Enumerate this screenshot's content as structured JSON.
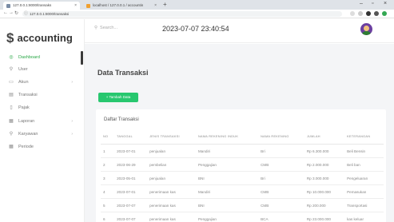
{
  "browser": {
    "tabs": [
      {
        "title": "127.0.0.1:8000/transaks",
        "active": true
      },
      {
        "title": "localhost / 127.0.0.1 / accountin",
        "active": false
      }
    ],
    "url": "127.0.0.1:8000/transaksi"
  },
  "sidebar": {
    "brand": "accounting",
    "items": [
      {
        "label": "Dashboard",
        "icon": "dashboard-icon",
        "glyph": "◎",
        "active": true,
        "chevron": false
      },
      {
        "label": "User",
        "icon": "user-icon",
        "glyph": "⚲",
        "active": false,
        "chevron": false
      },
      {
        "label": "Akun",
        "icon": "folder-icon",
        "glyph": "▭",
        "active": false,
        "chevron": true
      },
      {
        "label": "Transaksi",
        "icon": "transaction-icon",
        "glyph": "▤",
        "active": false,
        "chevron": false
      },
      {
        "label": "Pajak",
        "icon": "document-icon",
        "glyph": "▯",
        "active": false,
        "chevron": false
      },
      {
        "label": "Laporan",
        "icon": "report-icon",
        "glyph": "▦",
        "active": false,
        "chevron": true
      },
      {
        "label": "Karyawan",
        "icon": "employee-icon",
        "glyph": "⚲",
        "active": false,
        "chevron": true
      },
      {
        "label": "Periode",
        "icon": "calendar-icon",
        "glyph": "▦",
        "active": false,
        "chevron": false
      }
    ]
  },
  "topbar": {
    "search_placeholder": "Search...",
    "datetime": "2023-07-07 23:40:54"
  },
  "main": {
    "page_title": "Data Transaksi",
    "add_button": "+ Tambah Data",
    "card_title": "Daftar Transaksi",
    "columns": [
      "NO",
      "TANGGAL",
      "JENIS TRANSAKSI",
      "NAMA REKENING INDUK",
      "NAMA REKENING",
      "JUMLAH",
      "KETERANGAN"
    ],
    "rows": [
      [
        "1",
        "2023-07-01",
        "penjualan",
        "Mandiri",
        "Bri",
        "Rp 6.300.000",
        "Beli Bensin"
      ],
      [
        "2",
        "2023-06-29",
        "pembelian",
        "Penggajian",
        "CMB",
        "Rp 2.000.000",
        "Beli ban"
      ],
      [
        "3",
        "2023-05-01",
        "penjualan",
        "BNI",
        "Bri",
        "Rp 3.000.000",
        "Pengeluaran"
      ],
      [
        "4",
        "2023-07-01",
        "penerimaan kas",
        "Mandiri",
        "CMB",
        "Rp 10.000.000",
        "Pemasukan"
      ],
      [
        "5",
        "2023-07-07",
        "penerimaan kas",
        "BNI",
        "CMB",
        "Rp 200.000",
        "Transportasi"
      ],
      [
        "6",
        "2023-07-07",
        "penerimaan kas",
        "Penggajian",
        "BCA",
        "Rp 23.000.000",
        "kas keluar"
      ]
    ]
  },
  "colors": {
    "accent": "#28c76f",
    "active_menu": "#28a745",
    "background": "#f4f5f7"
  }
}
